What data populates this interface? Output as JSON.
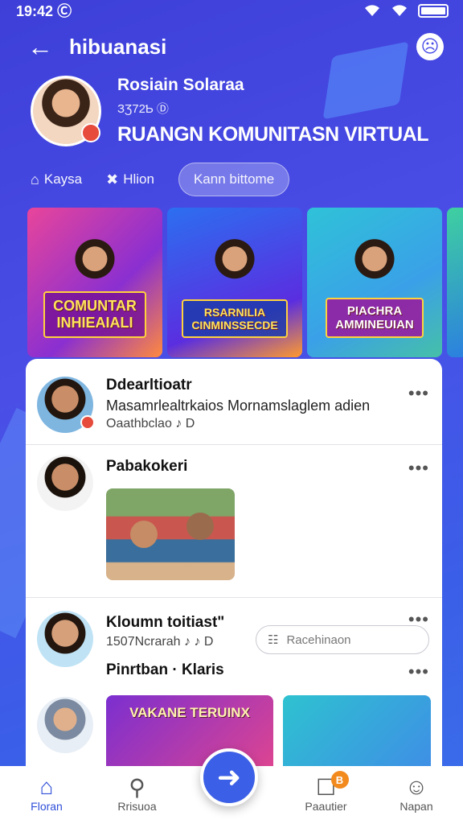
{
  "status": {
    "time": "19:42",
    "time_icon": "Ⓒ"
  },
  "header": {
    "title": "hibuanasi",
    "back_icon": "←",
    "face_icon": "☹"
  },
  "profile": {
    "name": "Rosiain Solaraa",
    "sub": "ЗƷ72Ƅ Ⓓ",
    "community": "RUANGN KOMUNITASN VIRTUAL"
  },
  "tabs": [
    {
      "label": "Kaysa",
      "icon": "⌂"
    },
    {
      "label": "Hlion",
      "icon": "✖"
    },
    {
      "label": "Kann bittome"
    }
  ],
  "banners": [
    {
      "label": "COMUNTAR\nINHIEAIALI"
    },
    {
      "label": "RSARNILIA\nCINMINSSECDE"
    },
    {
      "label": "PIACHRA\nAMMINEUIAN"
    }
  ],
  "feed": {
    "posts": [
      {
        "title": "Ddearltioatr",
        "body": "Masamrlealtrkaios Mornamslaglem adien",
        "meta": "Oaathbclao ♪ D"
      },
      {
        "title": "Pabakokeri"
      },
      {
        "title": "Kloumn toitiast\"",
        "meta": "1507Ncrarah ♪ ♪ D",
        "reply_placeholder": "Racehinaon",
        "reply_icon": "☷"
      },
      {
        "title": "Pinrtban · Klaris",
        "thumbs": [
          "VAKANE TERUINX",
          ""
        ]
      }
    ],
    "more_icon": "•••"
  },
  "fab": {
    "icon": "➜"
  },
  "bottom_nav": [
    {
      "label": "Floran",
      "icon": "⌂"
    },
    {
      "label": "Rrisuoa",
      "icon": "⚲"
    },
    {
      "label": "Paautier",
      "icon": "☐",
      "badge": "B"
    },
    {
      "label": "Napan",
      "icon": "☺"
    }
  ],
  "colors": {
    "accent": "#3b5fe6",
    "badge": "#f28a1e",
    "background": "#4a4ee6"
  }
}
